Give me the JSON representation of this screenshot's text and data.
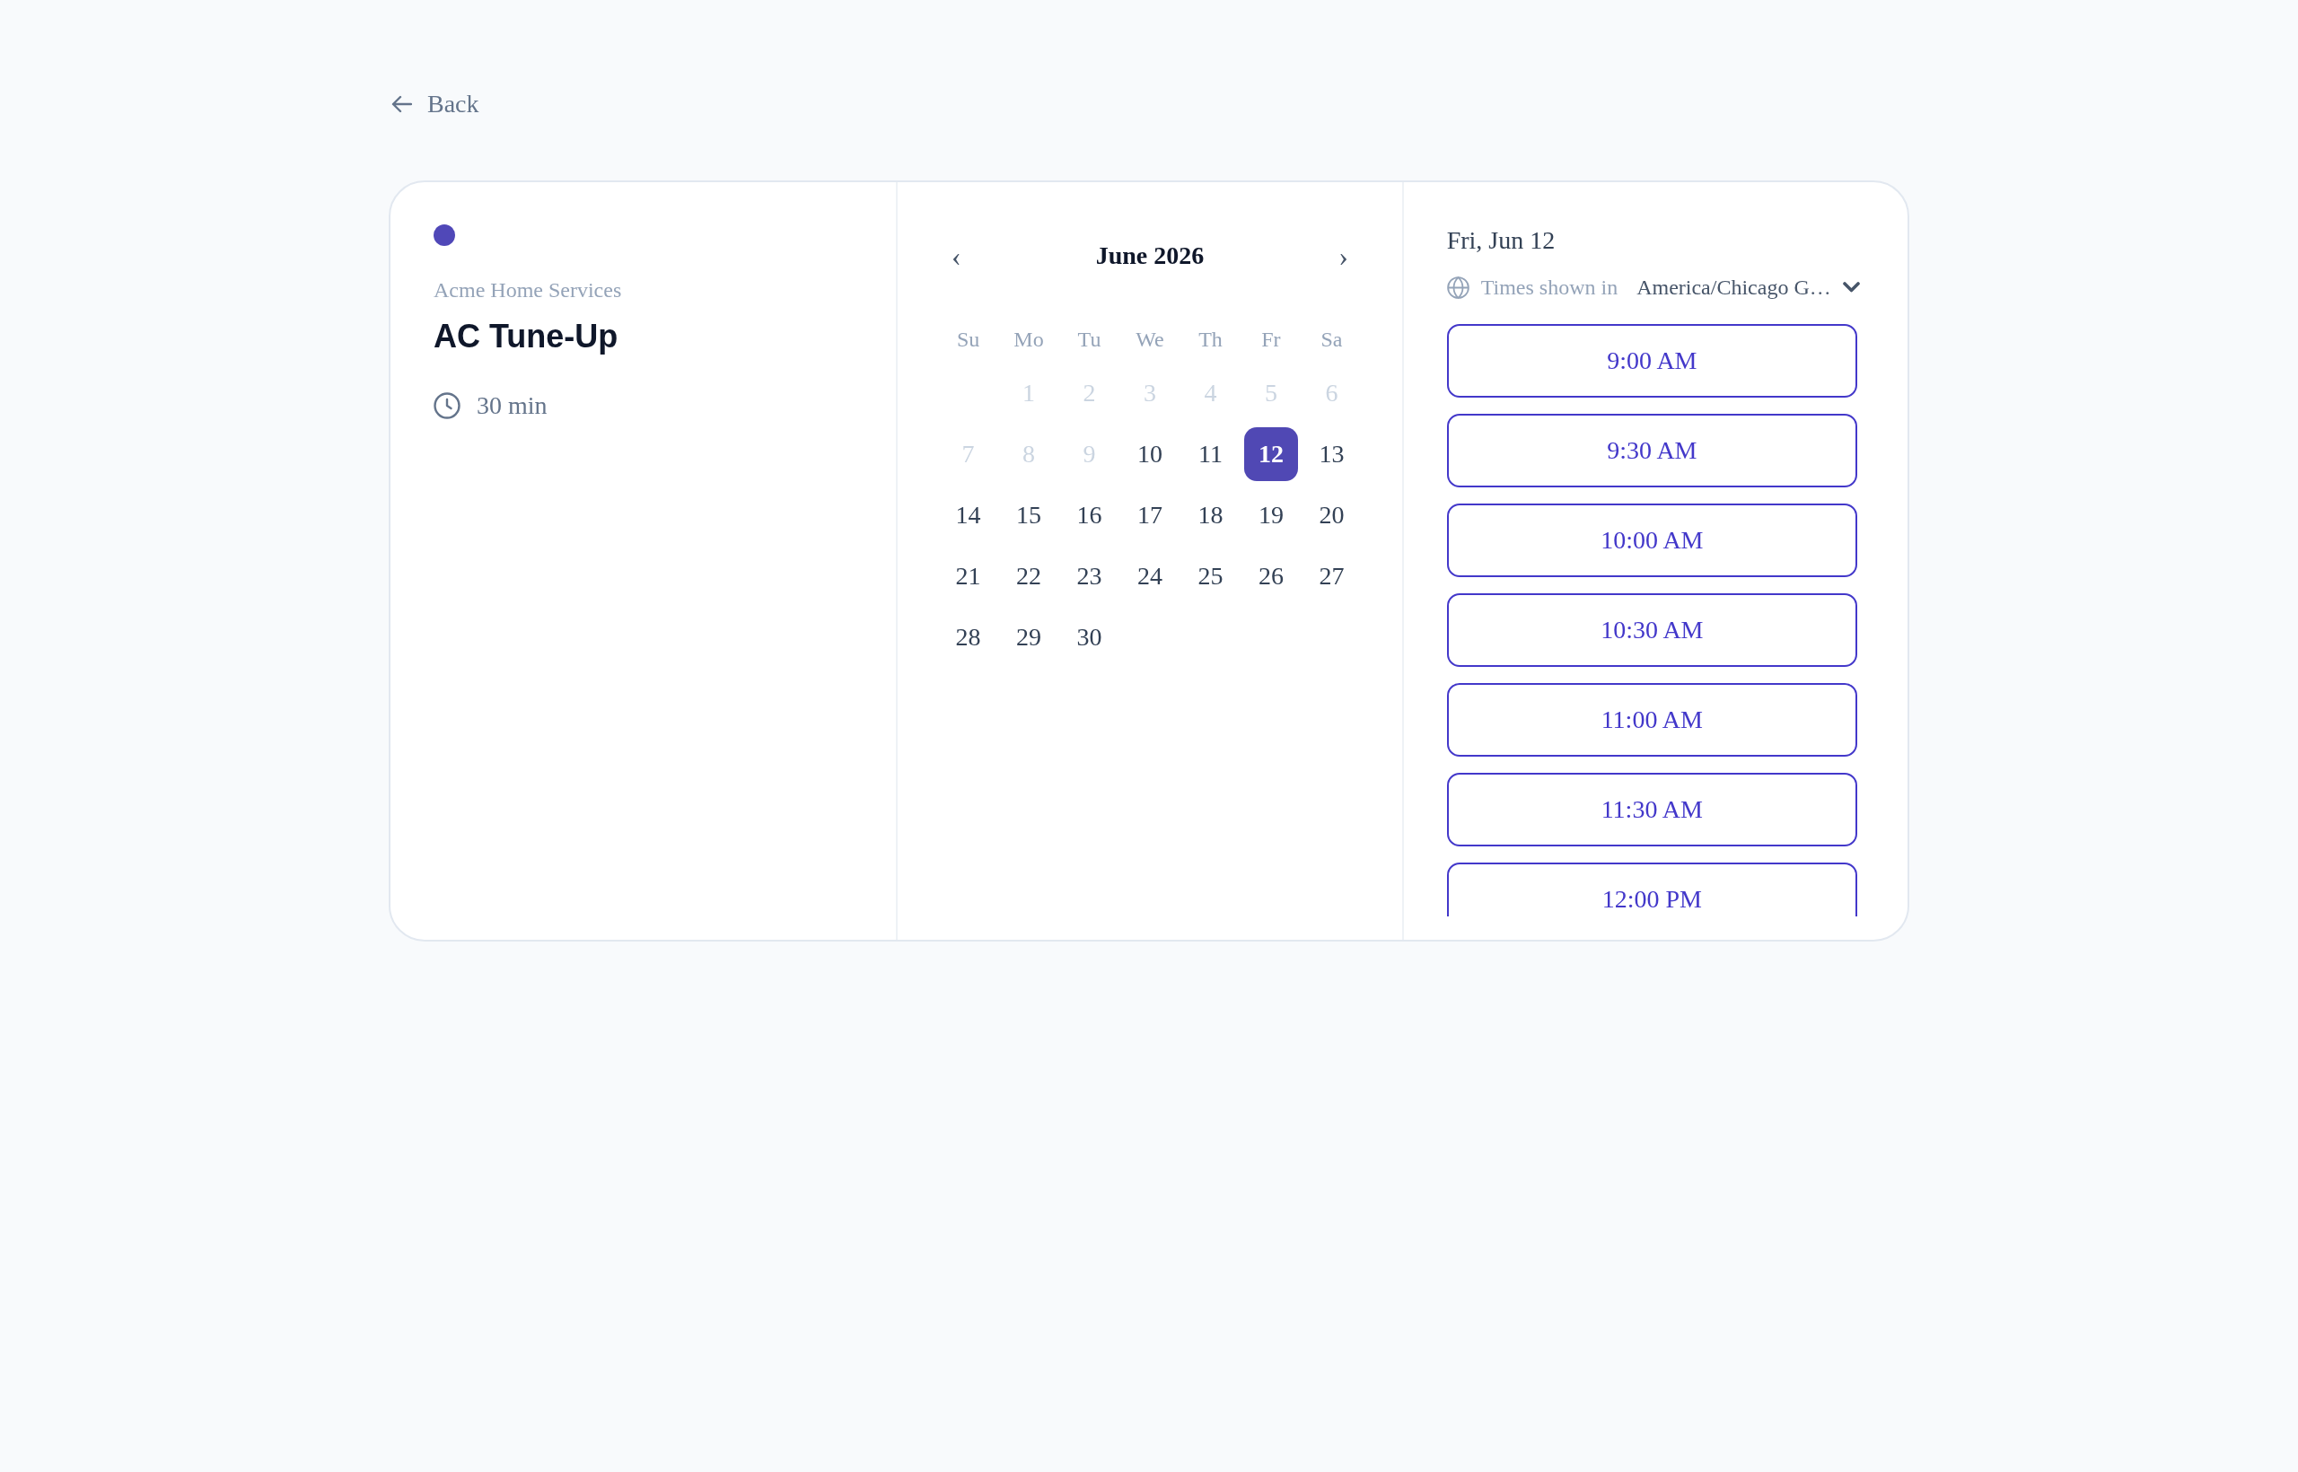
{
  "back_link": {
    "label": "Back"
  },
  "event": {
    "organization": "Acme Home Services",
    "title": "AC Tune-Up",
    "duration": "30 min"
  },
  "calendar": {
    "month": "June 2026",
    "prev_button": "‹",
    "next_button": "›",
    "weekdays": [
      "Su",
      "Mo",
      "Tu",
      "We",
      "Th",
      "Fr",
      "Sa"
    ],
    "weeks": [
      {
        "days": [
          {
            "label": "1",
            "disabled": true,
            "selected": false
          },
          {
            "label": "2",
            "disabled": true,
            "selected": false
          },
          {
            "label": "3",
            "disabled": true,
            "selected": false
          },
          {
            "label": "4",
            "disabled": true,
            "selected": false
          },
          {
            "label": "5",
            "disabled": true,
            "selected": false
          },
          {
            "label": "6",
            "disabled": true,
            "selected": false
          }
        ]
      },
      {
        "days": [
          {
            "label": "7",
            "disabled": true,
            "selected": false
          },
          {
            "label": "8",
            "disabled": true,
            "selected": false
          },
          {
            "label": "9",
            "disabled": true,
            "selected": false
          },
          {
            "label": "10",
            "disabled": false,
            "selected": false
          },
          {
            "label": "11",
            "disabled": false,
            "selected": false
          },
          {
            "label": "12",
            "disabled": false,
            "selected": true
          },
          {
            "label": "13",
            "disabled": false,
            "selected": false
          }
        ]
      },
      {
        "days": [
          {
            "label": "14",
            "disabled": false,
            "selected": false
          },
          {
            "label": "15",
            "disabled": false,
            "selected": false
          },
          {
            "label": "16",
            "disabled": false,
            "selected": false
          },
          {
            "label": "17",
            "disabled": false,
            "selected": false
          },
          {
            "label": "18",
            "disabled": false,
            "selected": false
          },
          {
            "label": "19",
            "disabled": false,
            "selected": false
          },
          {
            "label": "20",
            "disabled": false,
            "selected": false
          }
        ]
      },
      {
        "days": [
          {
            "label": "21",
            "disabled": false,
            "selected": false
          },
          {
            "label": "22",
            "disabled": false,
            "selected": false
          },
          {
            "label": "23",
            "disabled": false,
            "selected": false
          },
          {
            "label": "24",
            "disabled": false,
            "selected": false
          },
          {
            "label": "25",
            "disabled": false,
            "selected": false
          },
          {
            "label": "26",
            "disabled": false,
            "selected": false
          },
          {
            "label": "27",
            "disabled": false,
            "selected": false
          }
        ]
      },
      {
        "days": [
          {
            "label": "28",
            "disabled": false,
            "selected": false
          },
          {
            "label": "29",
            "disabled": false,
            "selected": false
          },
          {
            "label": "30",
            "disabled": false,
            "selected": false
          }
        ]
      }
    ]
  },
  "times": {
    "date": "Fri, Jun 12",
    "timezone_label": "Times shown in",
    "timezone": "America/Chicago G…",
    "slots": [
      {
        "label": "9:00 AM",
        "selected": false
      },
      {
        "label": "9:30 AM",
        "selected": false
      },
      {
        "label": "10:00 AM",
        "selected": false
      },
      {
        "label": "10:30 AM",
        "selected": false
      },
      {
        "label": "11:00 AM",
        "selected": false
      },
      {
        "label": "11:30 AM",
        "selected": false
      },
      {
        "label": "12:00 PM",
        "selected": false
      }
    ]
  }
}
